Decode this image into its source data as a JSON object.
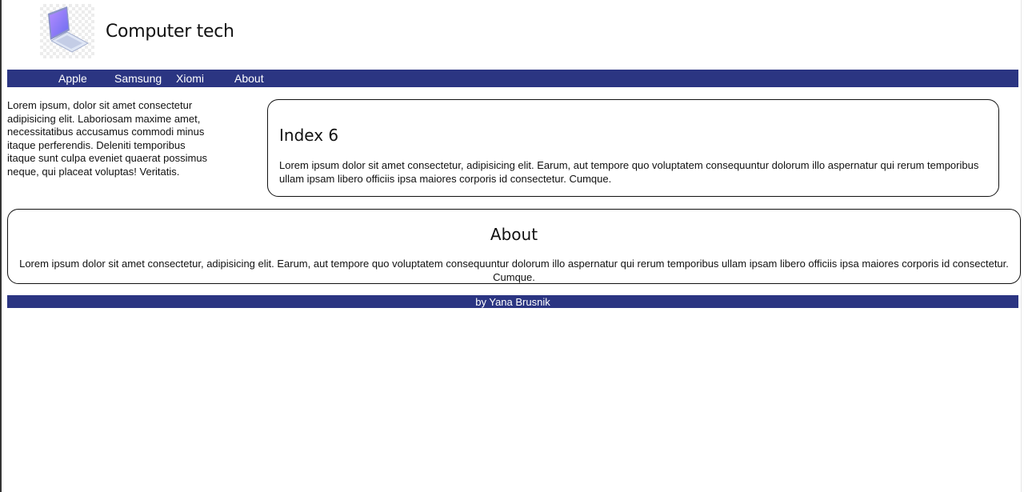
{
  "header": {
    "logo_icon": "laptop-icon",
    "title": "Computer tech"
  },
  "nav": {
    "items": [
      "Apple",
      "Samsung",
      "Xiomi",
      "About"
    ]
  },
  "sidebar": {
    "text": "Lorem ipsum, dolor sit amet consectetur adipisicing elit. Laboriosam maxime amet, necessitatibus accusamus commodi minus itaque perferendis. Deleniti temporibus itaque sunt culpa eveniet quaerat possimus neque, qui placeat voluptas! Veritatis."
  },
  "main": {
    "title": "Index 6",
    "text": "Lorem ipsum dolor sit amet consectetur, adipisicing elit. Earum, aut tempore quo voluptatem consequuntur dolorum illo aspernatur qui rerum temporibus ullam ipsam libero officiis ipsa maiores corporis id consectetur. Cumque."
  },
  "about": {
    "title": "About",
    "text": "Lorem ipsum dolor sit amet consectetur, adipisicing elit. Earum, aut tempore quo voluptatem consequuntur dolorum illo aspernatur qui rerum temporibus ullam ipsam libero officiis ipsa maiores corporis id consectetur. Cumque."
  },
  "footer": {
    "text": "by Yana Brusnik"
  },
  "colors": {
    "nav_background": "#2b3582",
    "footer_background": "#2b3582",
    "text": "#111111",
    "nav_text": "#ffffff"
  }
}
